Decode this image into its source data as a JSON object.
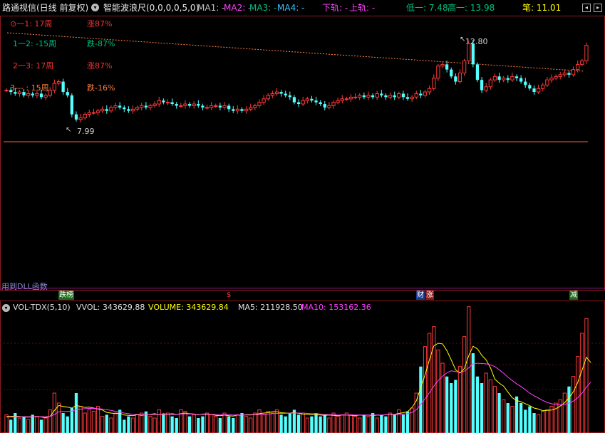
{
  "header": {
    "stock_title": "路通视信(日线 前复权)",
    "indicator_name": "智能波浪尺(0,0,0,0,5,0)",
    "ma1": "MA1: -",
    "ma2": "MA2: -",
    "ma3": "MA3: -",
    "ma4": "MA4: -",
    "lower_rail": "下轨: -",
    "upper_rail": "上轨: -",
    "low": "低一: 7.48",
    "high": "高一: 13.98",
    "stroke": "笔: 11.01",
    "colors": {
      "ma1": "#c0c0c0",
      "ma2": "#ff40ff",
      "ma3": "#00c080",
      "ma4": "#40c0ff",
      "rail": "#ff40ff",
      "low": "#00c080",
      "high": "#00c080",
      "stroke": "#ffff00"
    }
  },
  "wave_ruler": [
    {
      "label": "⊙一1:  17周",
      "change": "涨87%",
      "color": "#ff3030"
    },
    {
      "label": "1一2:  -15周",
      "change": "跌-87%",
      "color": "#00c080"
    },
    {
      "label": "2一3:  17周",
      "change": "涨87%",
      "color": "#ff3030"
    },
    {
      "label": "3--- :  15周",
      "change": "跌-16%",
      "color": "#ff8040"
    }
  ],
  "price_annotations": {
    "high_label": "12.80",
    "low_label": "7.99"
  },
  "dll_text": "用到DLL函数",
  "event_markers": [
    {
      "text": "跌榜",
      "bg": "#1a6b1a",
      "fg": "#ffffff"
    },
    {
      "text": "$",
      "bg": "#000000",
      "fg": "#ff3030"
    },
    {
      "text": "财",
      "bg": "#1a3a8b",
      "fg": "#ffffff"
    },
    {
      "text": "涨",
      "bg": "#8b1a1a",
      "fg": "#ffffff"
    },
    {
      "text": "减",
      "bg": "#1a6b1a",
      "fg": "#ffffff"
    }
  ],
  "volume_header": {
    "name": "VOL-TDX(5,10)",
    "vvol": "VVOL: 343629.88",
    "volume": "VOLUME: 343629.84",
    "ma5": "MA5: 211928.50",
    "ma10": "MA10: 153162.36"
  },
  "nav_icons": [
    "chevron-left-icon",
    "chevron-right-icon"
  ],
  "chart_data": {
    "type": "candlestick+volume",
    "price_range": [
      7.48,
      13.98
    ],
    "ohlc_close_series": [
      9.7,
      9.6,
      9.5,
      9.6,
      9.4,
      9.5,
      9.4,
      9.5,
      9.3,
      9.4,
      9.7,
      10.1,
      10.2,
      9.6,
      9.4,
      8.3,
      8.0,
      8.1,
      8.3,
      8.4,
      8.4,
      8.5,
      8.6,
      8.5,
      8.7,
      8.8,
      8.7,
      8.6,
      8.5,
      8.6,
      8.7,
      8.8,
      8.7,
      8.8,
      8.9,
      9.1,
      9.0,
      9.0,
      8.9,
      8.8,
      8.8,
      8.9,
      8.8,
      8.9,
      8.8,
      8.7,
      8.7,
      8.8,
      8.8,
      8.7,
      8.8,
      8.6,
      8.5,
      8.6,
      8.5,
      8.6,
      8.7,
      8.8,
      9.0,
      9.2,
      9.4,
      9.5,
      9.6,
      9.5,
      9.4,
      9.3,
      9.0,
      8.9,
      9.1,
      9.2,
      9.1,
      9.0,
      8.9,
      8.7,
      8.8,
      9.0,
      9.1,
      9.2,
      9.2,
      9.3,
      9.3,
      9.4,
      9.3,
      9.4,
      9.3,
      9.5,
      9.4,
      9.3,
      9.4,
      9.3,
      9.5,
      9.3,
      9.2,
      9.3,
      9.5,
      9.4,
      9.6,
      9.8,
      10.4,
      11.1,
      11.2,
      10.9,
      10.5,
      10.2,
      10.7,
      11.4,
      12.4,
      11.2,
      10.3,
      9.7,
      9.9,
      10.3,
      10.5,
      10.3,
      10.4,
      10.3,
      10.5,
      10.4,
      10.2,
      10.0,
      9.8,
      9.6,
      9.8,
      10.0,
      10.3,
      10.4,
      10.5,
      10.6,
      10.7,
      10.6,
      10.9,
      11.2,
      11.4,
      12.3
    ],
    "volume_range": [
      0,
      630000
    ],
    "volume_series": [
      55,
      40,
      60,
      45,
      50,
      40,
      55,
      50,
      40,
      45,
      70,
      120,
      90,
      60,
      50,
      75,
      120,
      80,
      60,
      70,
      65,
      80,
      50,
      55,
      45,
      60,
      70,
      40,
      50,
      45,
      55,
      60,
      65,
      50,
      45,
      70,
      55,
      60,
      50,
      45,
      70,
      65,
      50,
      55,
      45,
      50,
      60,
      55,
      50,
      45,
      60,
      50,
      45,
      55,
      60,
      50,
      45,
      60,
      70,
      55,
      65,
      60,
      70,
      55,
      50,
      60,
      70,
      55,
      60,
      45,
      50,
      60,
      50,
      55,
      45,
      60,
      50,
      55,
      60,
      55,
      50,
      45,
      55,
      50,
      60,
      45,
      55,
      50,
      60,
      55,
      70,
      55,
      65,
      75,
      120,
      200,
      260,
      300,
      320,
      250,
      210,
      170,
      150,
      160,
      200,
      290,
      380,
      240,
      170,
      150,
      180,
      160,
      140,
      120,
      100,
      90,
      80,
      110,
      90,
      70,
      80,
      60,
      55,
      65,
      70,
      80,
      90,
      100,
      120,
      140,
      170,
      230,
      300,
      344
    ],
    "ma5_series": [
      50,
      50,
      51,
      50,
      48,
      48,
      48,
      50,
      48,
      46,
      50,
      68,
      83,
      80,
      78,
      75,
      83,
      80,
      77,
      78,
      75,
      72,
      69,
      62,
      60,
      58,
      60,
      54,
      53,
      52,
      55,
      53,
      55,
      56,
      58,
      55,
      58,
      56,
      58,
      56,
      58,
      60,
      58,
      57,
      55,
      57,
      57,
      56,
      53,
      52,
      54,
      52,
      51,
      54,
      53,
      55,
      55,
      56,
      58,
      60,
      61,
      64,
      64,
      61,
      60,
      60,
      62,
      59,
      57,
      56,
      55,
      55,
      54,
      53,
      54,
      53,
      52,
      54,
      54,
      53,
      52,
      54,
      53,
      54,
      52,
      54,
      53,
      55,
      56,
      56,
      59,
      61,
      64,
      77,
      97,
      136,
      175,
      220,
      262,
      270,
      268,
      248,
      220,
      190,
      180,
      194,
      232,
      261,
      253,
      234,
      220,
      196,
      162,
      150,
      141,
      123,
      106,
      98,
      94,
      88,
      82,
      75,
      72,
      67,
      68,
      69,
      73,
      81,
      91,
      106,
      124,
      152,
      189,
      228,
      212
    ],
    "ma10_series": [
      48,
      48,
      49,
      49,
      49,
      49,
      49,
      49,
      49,
      49,
      50,
      56,
      64,
      65,
      65,
      66,
      70,
      72,
      73,
      74,
      74,
      73,
      72,
      70,
      68,
      65,
      63,
      60,
      58,
      56,
      56,
      55,
      55,
      55,
      56,
      56,
      56,
      56,
      56,
      56,
      57,
      58,
      57,
      57,
      56,
      56,
      56,
      56,
      56,
      55,
      55,
      55,
      54,
      54,
      54,
      54,
      54,
      55,
      55,
      56,
      57,
      58,
      59,
      59,
      59,
      60,
      60,
      60,
      60,
      59,
      58,
      58,
      57,
      56,
      55,
      55,
      54,
      54,
      54,
      54,
      54,
      54,
      54,
      54,
      54,
      54,
      54,
      55,
      55,
      55,
      56,
      57,
      58,
      62,
      70,
      86,
      103,
      121,
      141,
      158,
      171,
      181,
      187,
      185,
      183,
      186,
      196,
      208,
      210,
      209,
      208,
      205,
      200,
      190,
      180,
      168,
      158,
      148,
      140,
      130,
      120,
      112,
      105,
      98,
      92,
      88,
      85,
      85,
      86,
      90,
      96,
      106,
      120,
      138,
      153
    ]
  }
}
